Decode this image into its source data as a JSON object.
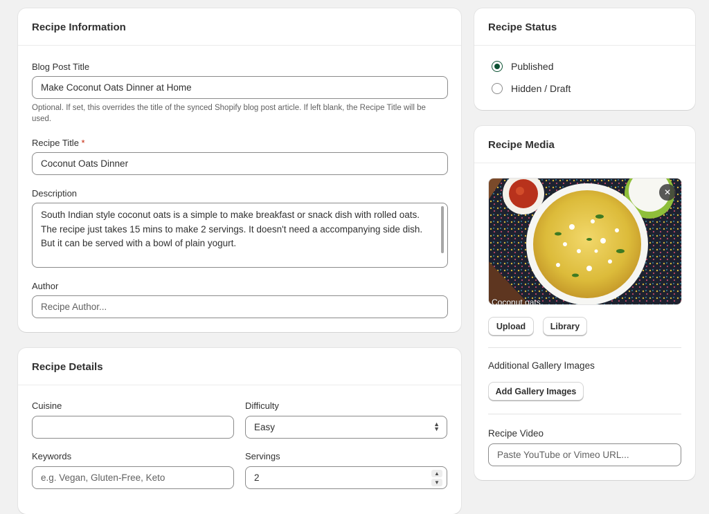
{
  "recipe_info": {
    "title": "Recipe Information",
    "blog_post_title_label": "Blog Post Title",
    "blog_post_title_value": "Make Coconut Oats Dinner at Home",
    "blog_post_title_help": "Optional. If set, this overrides the title of the synced Shopify blog post article. If left blank, the Recipe Title will be used.",
    "recipe_title_label": "Recipe Title",
    "required_marker": "*",
    "recipe_title_value": "Coconut Oats Dinner",
    "description_label": "Description",
    "description_value": "South Indian style coconut oats is a simple to make breakfast or snack dish with rolled oats. The recipe just takes 15 mins to make 2 servings. It doesn't need a accompanying side dish. But it can be served with a bowl of plain yogurt.",
    "author_label": "Author",
    "author_placeholder": "Recipe Author..."
  },
  "recipe_details": {
    "title": "Recipe Details",
    "cuisine_label": "Cuisine",
    "cuisine_value": "",
    "difficulty_label": "Difficulty",
    "difficulty_value": "Easy",
    "keywords_label": "Keywords",
    "keywords_placeholder": "e.g. Vegan, Gluten-Free, Keto",
    "servings_label": "Servings",
    "servings_value": "2"
  },
  "recipe_status": {
    "title": "Recipe Status",
    "options": [
      {
        "label": "Published",
        "checked": true
      },
      {
        "label": "Hidden / Draft",
        "checked": false
      }
    ]
  },
  "recipe_media": {
    "title": "Recipe Media",
    "image_caption": "Coconut oats",
    "remove_icon": "close-icon",
    "upload_label": "Upload",
    "library_label": "Library",
    "gallery_label": "Additional Gallery Images",
    "add_gallery_label": "Add Gallery Images",
    "video_label": "Recipe Video",
    "video_placeholder": "Paste YouTube or Vimeo URL..."
  },
  "colors": {
    "background": "#f1f1f1",
    "card": "#ffffff",
    "radio_checked": "#0c5132",
    "required": "#c5280c"
  }
}
